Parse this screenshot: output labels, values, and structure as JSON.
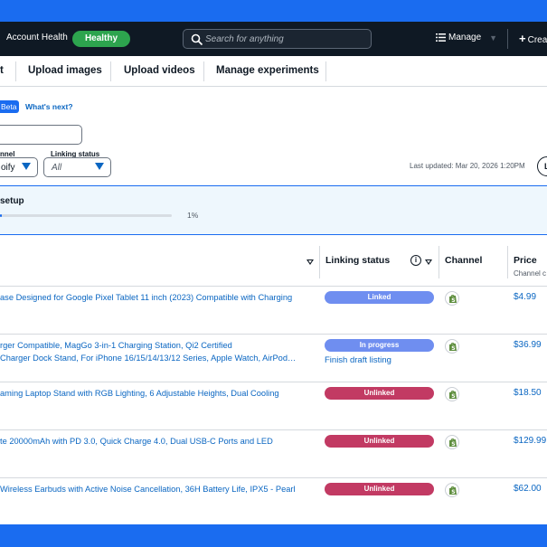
{
  "nav": {
    "account_label": "Account Health",
    "health_badge": "Healthy",
    "search_placeholder": "Search for anything",
    "manage_label": "Manage",
    "create_label": "Crea"
  },
  "tabs": [
    {
      "label": "t"
    },
    {
      "label": "Upload images"
    },
    {
      "label": "Upload videos"
    },
    {
      "label": "Manage experiments"
    }
  ],
  "beta_badge": "Beta",
  "whats_next": "What's next?",
  "filters": {
    "channel": {
      "label": "nnel",
      "value": "oify"
    },
    "linking_status": {
      "label": "Linking status",
      "value": "All"
    }
  },
  "last_updated": "Last updated: Mar 20, 2026 1:20PM",
  "refresh_button": "L",
  "setup": {
    "title": "setup",
    "progress_percent": 1,
    "progress_label": "1%"
  },
  "columns": {
    "title": "",
    "linking_status": "Linking status",
    "channel": "Channel",
    "price": "Price",
    "price_sub": "Channel c"
  },
  "colors": {
    "linked": "#6f8ef0",
    "in_progress": "#6f8ef0",
    "unlinked": "#c23a63",
    "accent": "#1a6cf0",
    "healthy": "#2da44e"
  },
  "rows": [
    {
      "title1": "ase Designed for Google Pixel Tablet 11 inch (2023) Compatible with Charging",
      "title2": "",
      "status": "Linked",
      "status_key": "linked",
      "action": "",
      "price": "$4.99"
    },
    {
      "title1": "rger Compatible, MagGo 3-in-1 Charging Station, Qi2 Certified",
      "title2": "Charger Dock Stand, For iPhone 16/15/14/13/12 Series, Apple Watch, AirPod…",
      "status": "In progress",
      "status_key": "in_progress",
      "action": "Finish draft listing",
      "price": "$36.99"
    },
    {
      "title1": "aming Laptop Stand with RGB Lighting, 6 Adjustable Heights, Dual Cooling",
      "title2": "",
      "status": "Unlinked",
      "status_key": "unlinked",
      "action": "",
      "price": "$18.50"
    },
    {
      "title1": "te 20000mAh with PD 3.0, Quick Charge 4.0, Dual USB-C Ports and LED",
      "title2": "",
      "status": "Unlinked",
      "status_key": "unlinked",
      "action": "",
      "price": "$129.99"
    },
    {
      "title1": " Wireless Earbuds with Active Noise Cancellation, 36H Battery Life, IPX5 - Pearl",
      "title2": "",
      "status": "Unlinked",
      "status_key": "unlinked",
      "action": "",
      "price": "$62.00"
    }
  ]
}
